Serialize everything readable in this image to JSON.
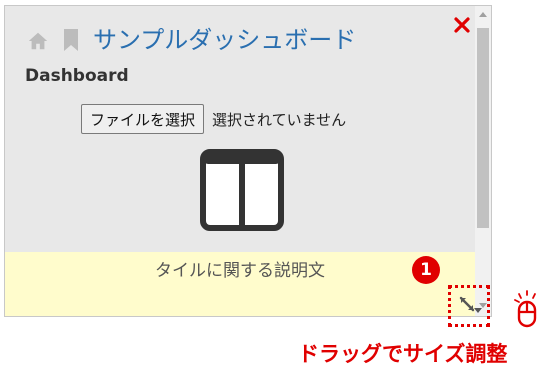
{
  "tile": {
    "title": "サンプルダッシュボード",
    "subtitle": "Dashboard",
    "file_button_label": "ファイルを選択",
    "file_status": "選択されていません",
    "description": "タイルに関する説明文"
  },
  "annotations": {
    "step_number": "1",
    "caption": "ドラッグでサイズ調整"
  },
  "icons": {
    "home": "home-icon",
    "bookmark": "bookmark-icon",
    "close": "close-icon",
    "layout": "two-column-layout-icon",
    "resize": "resize-handle-icon",
    "mouse": "mouse-click-icon"
  },
  "colors": {
    "title": "#2a6fb0",
    "close": "#e00000",
    "tile_background": "#e8e8e8",
    "description_background": "#fffccc",
    "annotation": "#e00000"
  }
}
